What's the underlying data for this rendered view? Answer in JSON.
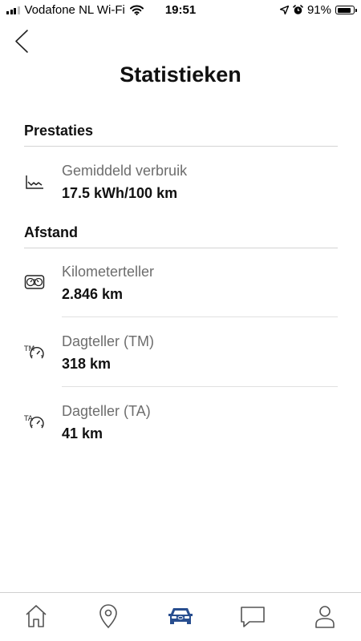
{
  "status_bar": {
    "carrier": "Vodafone NL Wi-Fi",
    "time": "19:51",
    "battery_text": "91%",
    "battery_level": 0.91
  },
  "header": {
    "title": "Statistieken"
  },
  "sections": [
    {
      "title": "Prestaties",
      "items": [
        {
          "label": "Gemiddeld verbruik",
          "value": "17.5 kWh/100 km",
          "icon": "chart-icon"
        }
      ]
    },
    {
      "title": "Afstand",
      "items": [
        {
          "label": "Kilometerteller",
          "value": "2.846 km",
          "icon": "odometer-icon"
        },
        {
          "label": "Dagteller (TM)",
          "value": "318 km",
          "icon": "trip-meter-tm-icon"
        },
        {
          "label": "Dagteller (TA)",
          "value": "41 km",
          "icon": "trip-meter-ta-icon"
        }
      ]
    }
  ],
  "tab_bar": {
    "tabs": [
      "home-icon",
      "location-icon",
      "car-icon",
      "chat-icon",
      "profile-icon"
    ],
    "active_tab": "car-icon",
    "active_color": "#284e8f",
    "inactive_color": "#555555"
  }
}
